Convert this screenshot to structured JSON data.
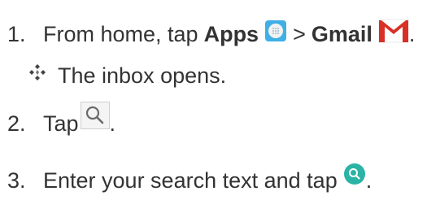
{
  "steps": [
    {
      "number": "1.",
      "text_before": "From home, tap",
      "apps_label": "Apps",
      "separator": ">",
      "gmail_label": "Gmail",
      "trailing": "."
    },
    {
      "number": "2.",
      "text_before": "Tap",
      "trailing": "."
    },
    {
      "number": "3.",
      "text_before": "Enter your search text and tap",
      "trailing": "."
    }
  ],
  "result": {
    "text": "The inbox opens."
  },
  "icons": {
    "apps": "apps-icon",
    "gmail": "gmail-icon",
    "search": "search-icon",
    "search_go": "search-go-icon",
    "bullet": "diamond-bullet-icon"
  },
  "colors": {
    "text": "#333333",
    "gmail_red": "#d93025",
    "apps_blue": "#3fb0e6",
    "search_teal": "#2bb3a5"
  }
}
